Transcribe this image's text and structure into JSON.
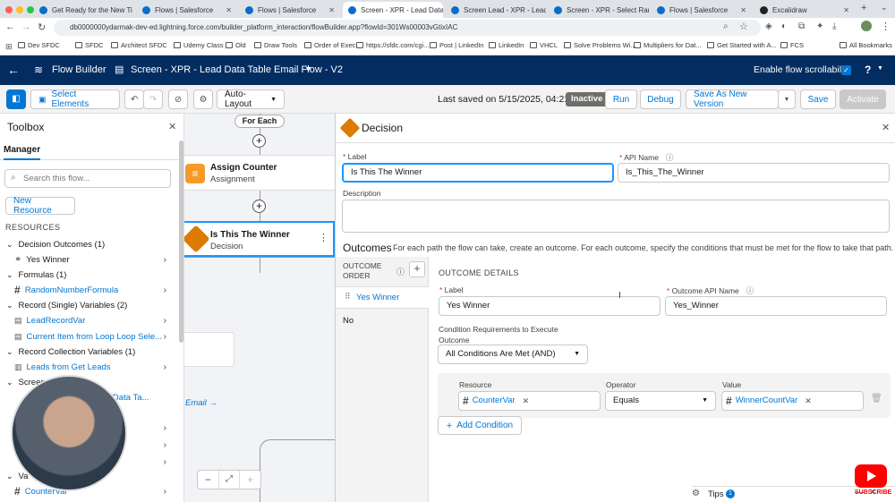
{
  "browser": {
    "tabs": [
      {
        "label": "Get Ready for the New Ti"
      },
      {
        "label": "Flows | Salesforce"
      },
      {
        "label": "Flows | Salesforce"
      },
      {
        "label": "Screen - XPR - Lead Data"
      },
      {
        "label": "Screen Lead - XPR - Lead"
      },
      {
        "label": "Screen - XPR - Select Ran"
      },
      {
        "label": "Flows | Salesforce"
      },
      {
        "label": "Excalidraw"
      }
    ],
    "url": "db0000000ydarmak-dev-ed.lightning.force.com/builder_platform_interaction/flowBuilder.app?flowId=301Ws00003vGtixIAC",
    "bookmarks": [
      "Dev SFDC",
      "SFDC",
      "Architect SFDC",
      "Udemy Class",
      "Old",
      "Draw Tools",
      "Order of Exec",
      "https://sfdc.com/cgi...",
      "Post | LinkedIn",
      "LinkedIn",
      "VHCL",
      "Solve Problems Wi...",
      "Multipliers for Dat...",
      "Get Started with A...",
      "FCS"
    ],
    "all_bookmarks": "All Bookmarks"
  },
  "header": {
    "app_name": "Flow Builder",
    "flow_title": "Screen - XPR - Lead Data Table Email Flow - V2",
    "scroll_label": "Enable flow scrollability"
  },
  "toolbar": {
    "select_elements": "Select Elements",
    "layout": "Auto-Layout",
    "last_saved": "Last saved on 5/15/2025, 04:21 PM",
    "status": "Inactive",
    "run": "Run",
    "debug": "Debug",
    "save_as_new": "Save As New Version",
    "save": "Save",
    "activate": "Activate"
  },
  "toolbox": {
    "title": "Toolbox",
    "tab": "Manager",
    "search_placeholder": "Search this flow...",
    "new_resource": "New Resource",
    "resources_heading": "RESOURCES",
    "sections": [
      {
        "label": "Decision Outcomes (1)",
        "items": [
          "Yes Winner"
        ]
      },
      {
        "label": "Formulas (1)",
        "items": [
          "RandomNumberFormula"
        ]
      },
      {
        "label": "Record (Single) Variables (2)",
        "items": [
          "LeadRecordVar",
          "Current Item from Loop Loop Sele..."
        ]
      },
      {
        "label": "Record Collection Variables (1)",
        "items": [
          "Leads from Get Leads"
        ]
      }
    ],
    "partial_section": "Screen",
    "partial_item": "d Data Ta...",
    "partial_var": "Va",
    "last_item": "CounterVar"
  },
  "canvas": {
    "for_each": "For Each",
    "assign_title": "Assign Counter",
    "assign_sub": "Assignment",
    "decision_title": "Is This The Winner",
    "decision_sub": "Decision",
    "email_link": "Email →"
  },
  "panel": {
    "title": "Decision",
    "label_label": "Label",
    "label_value": "Is This The Winner",
    "api_label": "API Name",
    "api_value": "Is_This_The_Winner",
    "description_label": "Description",
    "outcomes_heading": "Outcomes",
    "outcomes_help": "For each path the flow can take, create an outcome. For each outcome, specify the conditions that must be met for the flow to take that path.",
    "outcome_order": "OUTCOME ORDER",
    "outcome_items": [
      "Yes Winner",
      "No"
    ],
    "outcome_details": "OUTCOME DETAILS",
    "outcome_label_label": "Label",
    "outcome_label_value": "Yes Winner",
    "outcome_api_label": "Outcome API Name",
    "outcome_api_value": "Yes_Winner",
    "cond_req_label": "Condition Requirements to Execute Outcome",
    "cond_req_value": "All Conditions Are Met (AND)",
    "resource_label": "Resource",
    "operator_label": "Operator",
    "value_label": "Value",
    "resource_value": "CounterVar",
    "operator_value": "Equals",
    "value_value": "WinnerCountVar",
    "add_condition": "Add Condition",
    "tips": "Tips",
    "tips_count": "1"
  },
  "overlay": {
    "subscribe": "SUBSCRIBE"
  },
  "colors": {
    "brand_dark": "#032d60",
    "accent": "#0176d3",
    "decision_orange": "#dd7a01"
  }
}
